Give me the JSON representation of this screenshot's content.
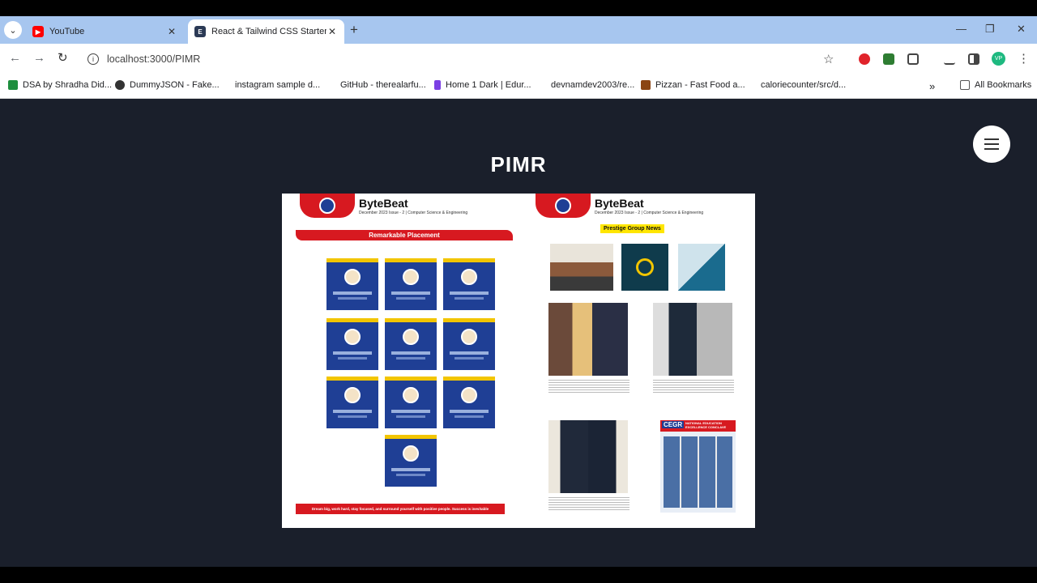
{
  "tabs": [
    {
      "label": "YouTube",
      "icon": "youtube-icon",
      "color": "#ff0000"
    },
    {
      "label": "React & Tailwind CSS Starter Pa",
      "icon": "e-logo-icon",
      "color": "#2b3a55"
    }
  ],
  "address_bar": {
    "url": "localhost:3000/PIMR"
  },
  "bookmarks": [
    {
      "label": "DSA by Shradha Did...",
      "color": "#1e8e3e"
    },
    {
      "label": "DummyJSON - Fake...",
      "color": "#333333"
    },
    {
      "label": "instagram sample d...",
      "color": ""
    },
    {
      "label": "GitHub - therealarfu...",
      "color": ""
    },
    {
      "label": "Home 1 Dark | Edur...",
      "color": "#7b3fe4"
    },
    {
      "label": "devnamdev2003/re...",
      "color": ""
    },
    {
      "label": "Pizzan - Fast Food a...",
      "color": "#8b4513"
    },
    {
      "label": "caloriecounter/src/d...",
      "color": ""
    }
  ],
  "all_bookmarks_label": "All Bookmarks",
  "profile_initials": "VP",
  "page": {
    "title": "PIMR",
    "magazine": {
      "left_page": {
        "masthead": "ByteBeat",
        "issue": "December 2023 Issue - 2 | Computer Science & Engineering",
        "section": "Remarkable Placement",
        "footer": "Dream big, work hard, stay focused, and surround yourself with positive people. Success is inevitable"
      },
      "right_page": {
        "masthead": "ByteBeat",
        "issue": "December 2023 Issue - 2 | Computer Science & Engineering",
        "section": "Prestige Group News",
        "poster_title": "NATIONAL EDUCATION EXCELLENCE CONCLAVE",
        "poster_brand": "CEGR"
      }
    }
  },
  "colors": {
    "page_bg": "#1a1f2b",
    "accent_red": "#d71920",
    "card_blue": "#1f3f95",
    "tag_yellow": "#ffe600"
  }
}
